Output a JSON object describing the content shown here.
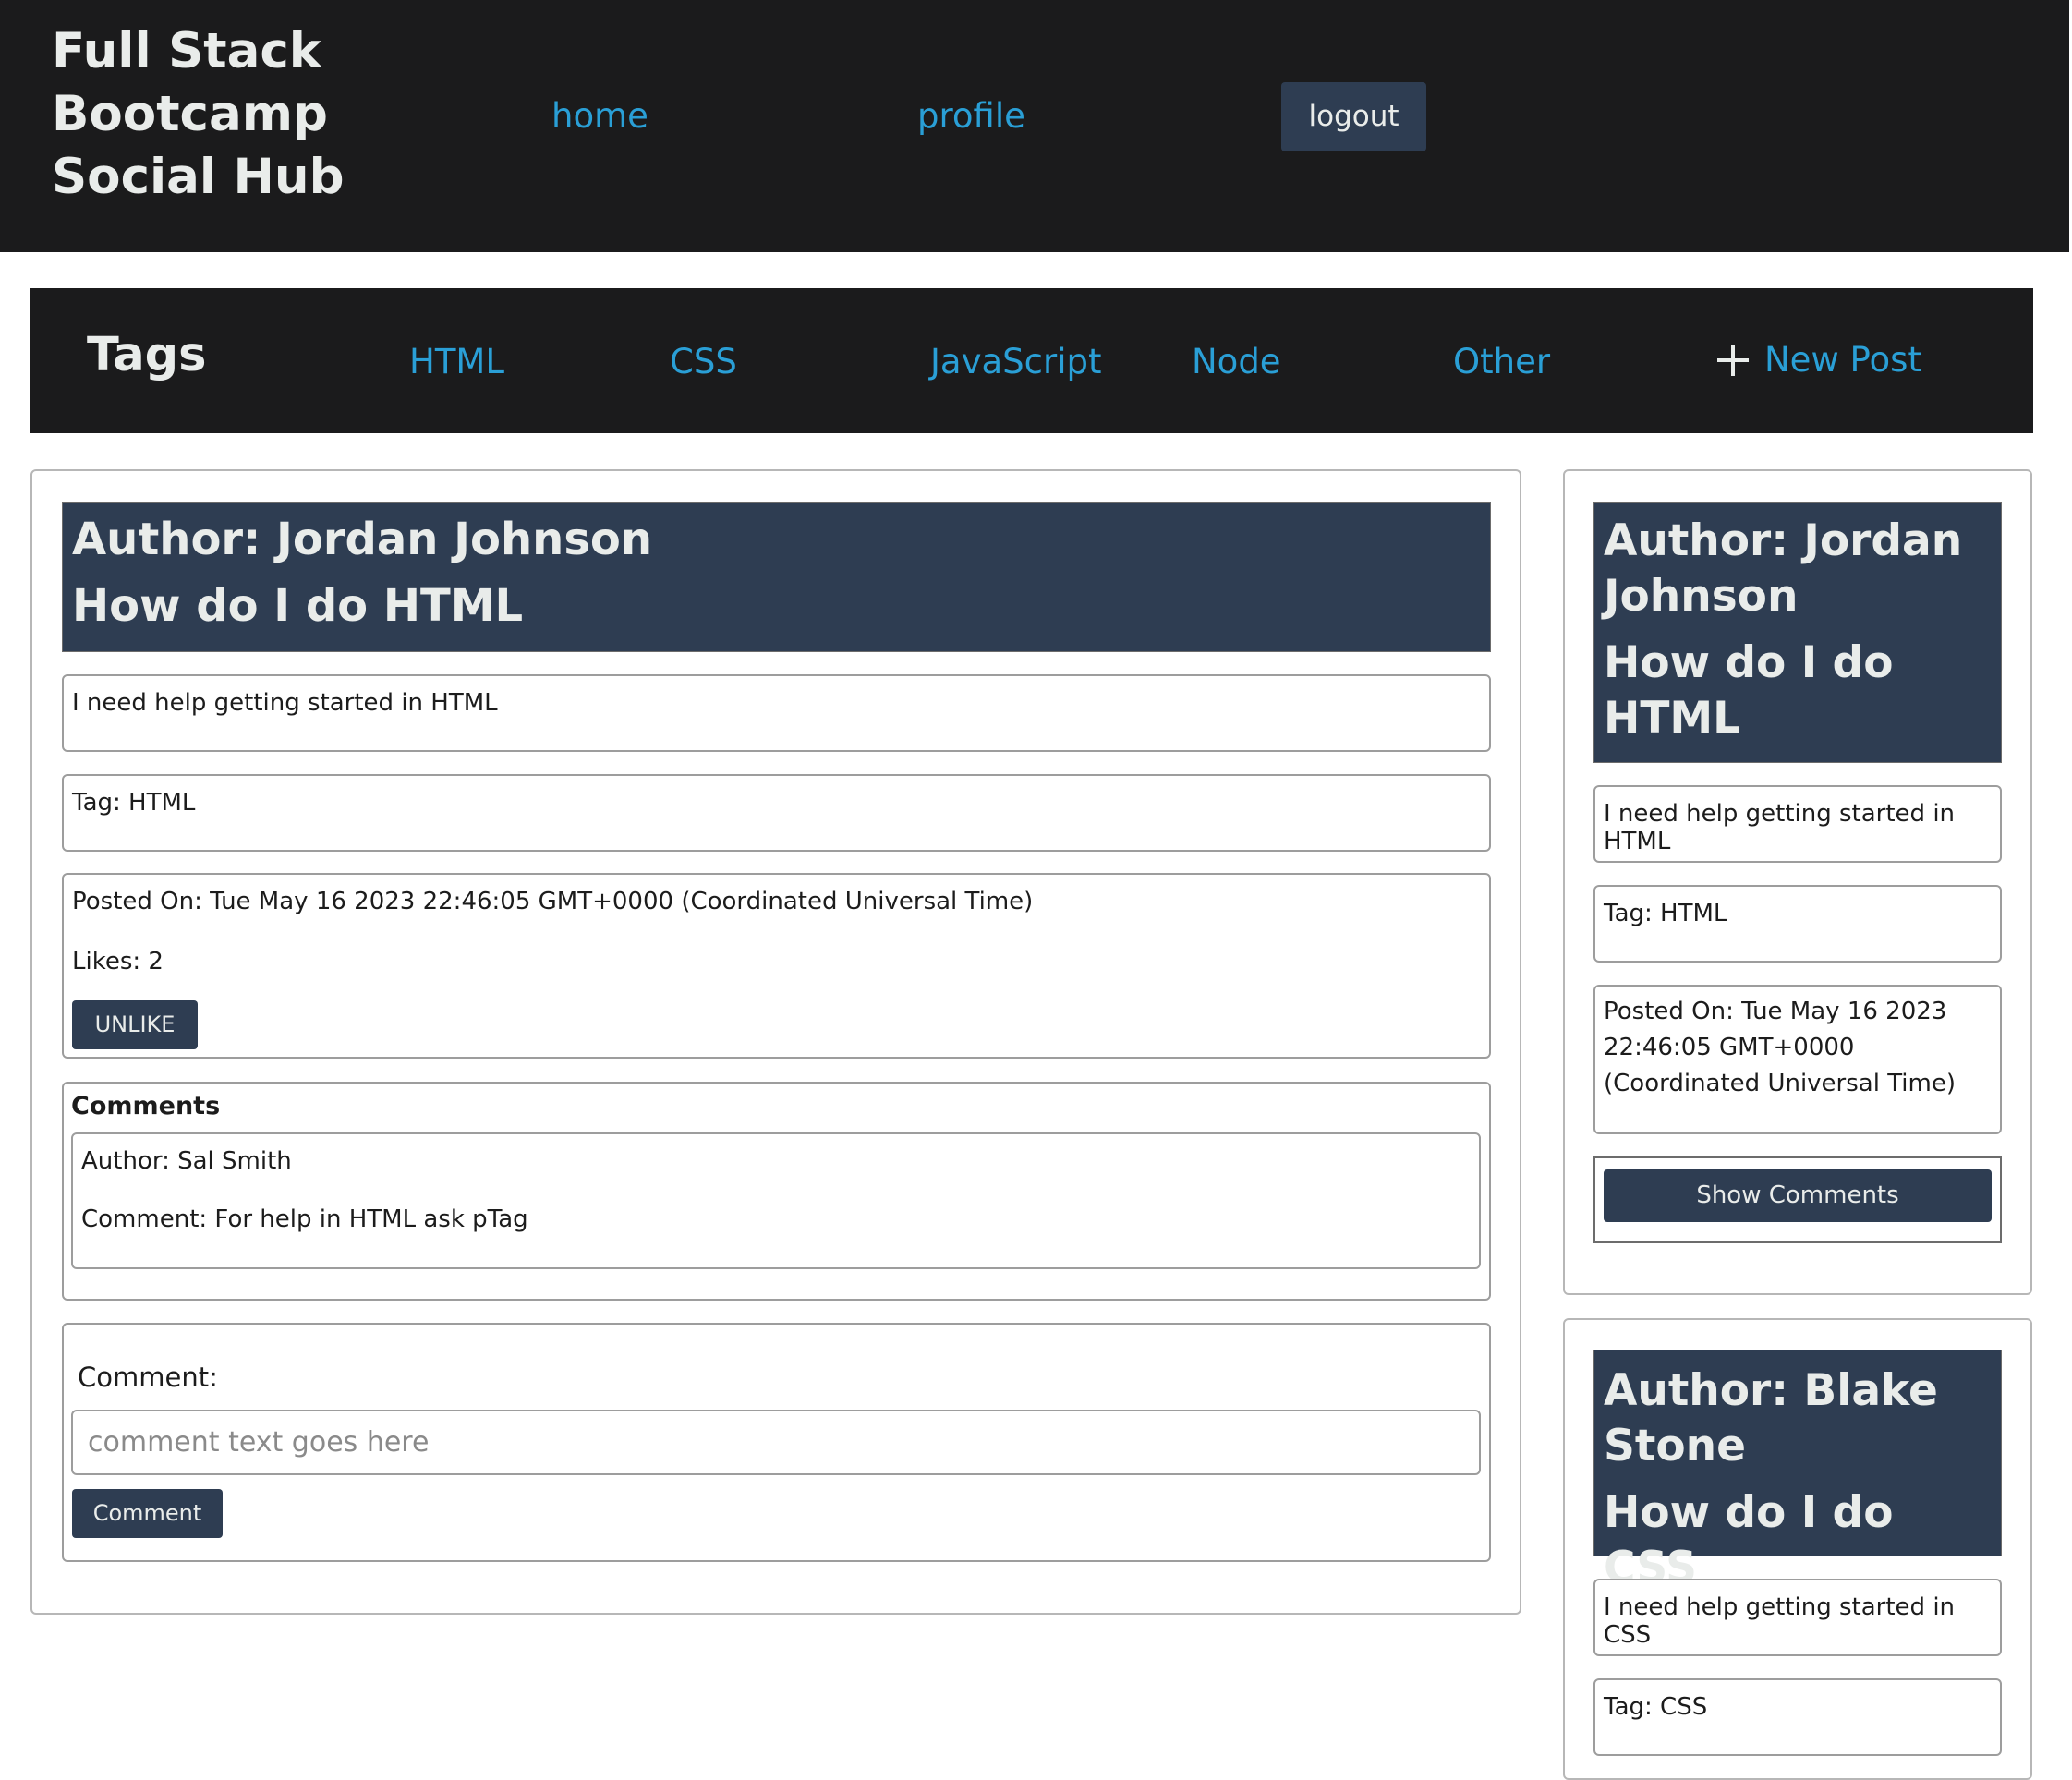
{
  "header": {
    "site_title": "Full Stack Bootcamp Social Hub",
    "nav": {
      "home": "home",
      "profile": "profile",
      "logout": "logout"
    }
  },
  "tags_bar": {
    "title": "Tags",
    "tags": [
      "HTML",
      "CSS",
      "JavaScript",
      "Node",
      "Other"
    ],
    "new_post": "New Post"
  },
  "main_post": {
    "author": "Author: Jordan Johnson",
    "title": "How do I do HTML",
    "body": "I need help getting started in HTML",
    "tag": "Tag: HTML",
    "posted_on": "Posted On: Tue May 16 2023 22:46:05 GMT+0000 (Coordinated Universal Time)",
    "likes": "Likes: 2",
    "unlike_label": "UNLIKE",
    "comments_heading": "Comments",
    "comments": [
      {
        "author": "Author: Sal Smith",
        "text": "Comment: For help in HTML ask pTag"
      }
    ],
    "comment_form": {
      "label": "Comment:",
      "placeholder": "comment text goes here",
      "submit_label": "Comment"
    }
  },
  "side_posts": [
    {
      "author": "Author: Jordan Johnson",
      "title": "How do I do HTML",
      "body": "I need help getting started in HTML",
      "tag": "Tag: HTML",
      "posted_on": "Posted On: Tue May 16 2023 22:46:05 GMT+0000 (Coordinated Universal Time)",
      "show_comments_label": "Show Comments"
    },
    {
      "author": "Author: Blake Stone",
      "title": "How do I do CSS",
      "body": "I need help getting started in CSS",
      "tag": "Tag: CSS"
    }
  ],
  "colors": {
    "nav_background": "#1b1b1c",
    "link": "#2a9fd6",
    "header_panel": "#2e3d52",
    "light_text": "#e9ecea"
  },
  "icons": {
    "new_post": "plus-icon"
  }
}
